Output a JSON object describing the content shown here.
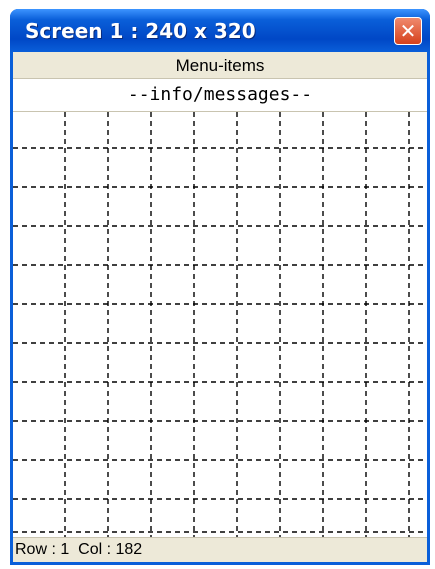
{
  "window": {
    "title": "Screen 1 : 240 x 320",
    "close_glyph": "✕",
    "close_icon": "close-icon"
  },
  "menu": {
    "label": "Menu-items"
  },
  "info": {
    "text": "--info/messages--"
  },
  "status": {
    "row_label": "Row : ",
    "row_value": "1",
    "col_label": "  Col : ",
    "col_value": "182"
  },
  "colors": {
    "titlebar": "#0a5fd9",
    "close_button": "#d6411c",
    "menubar": "#ede9d8",
    "grid_lines": "#000000"
  }
}
